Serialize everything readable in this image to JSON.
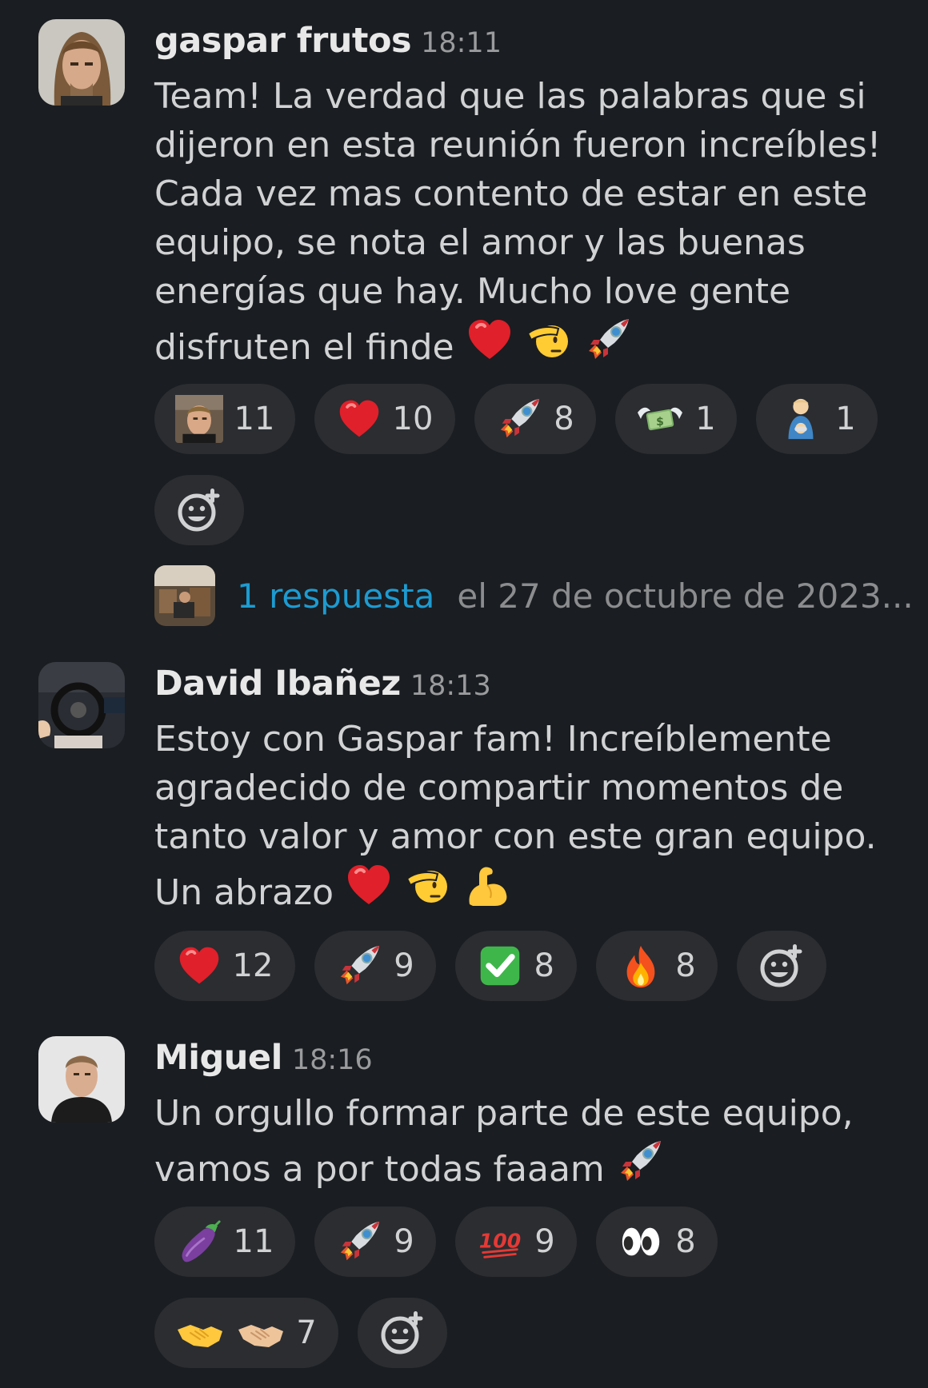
{
  "colors": {
    "background": "#1a1d21",
    "pill": "#2b2d31",
    "link": "#1d9bd1",
    "text": "#d1d2d3",
    "muted": "#9a9b9d"
  },
  "messages": [
    {
      "author": "gaspar frutos",
      "time": "18:11",
      "lines": [
        "Team! La verdad que las palabras que si",
        "dijeron en esta reunión fueron increíbles!",
        "Cada vez mas contento de estar en este",
        "equipo, se nota el amor y las buenas",
        "energías que hay. Mucho love gente",
        "disfruten el finde"
      ],
      "inline_emojis": [
        "red-heart",
        "saluting-face",
        "rocket"
      ],
      "reactions": [
        {
          "icon": "custom-face-emoji",
          "count": "11"
        },
        {
          "icon": "red-heart",
          "count": "10"
        },
        {
          "icon": "rocket",
          "count": "8"
        },
        {
          "icon": "money-with-wings",
          "count": "1"
        },
        {
          "icon": "baby-bottle-person",
          "count": "1"
        }
      ],
      "thread": {
        "replies": "1 respuesta",
        "date": "el 27 de octubre de 2023..."
      }
    },
    {
      "author": "David Ibañez",
      "time": "18:13",
      "lines": [
        "Estoy con Gaspar fam! Increíblemente",
        "agradecido de compartir momentos de",
        "tanto valor y amor con este gran equipo.",
        "Un abrazo"
      ],
      "inline_emojis": [
        "red-heart",
        "saluting-face",
        "flexed-biceps"
      ],
      "reactions": [
        {
          "icon": "red-heart",
          "count": "12"
        },
        {
          "icon": "rocket",
          "count": "9"
        },
        {
          "icon": "check-mark-button",
          "count": "8"
        },
        {
          "icon": "fire",
          "count": "8"
        }
      ]
    },
    {
      "author": "Miguel",
      "time": "18:16",
      "lines": [
        "Un orgullo formar parte de este equipo,",
        "vamos a por todas faaam"
      ],
      "inline_emojis": [
        "rocket"
      ],
      "reactions": [
        {
          "icon": "eggplant",
          "count": "11"
        },
        {
          "icon": "rocket",
          "count": "9"
        },
        {
          "icon": "hundred-points",
          "count": "9"
        },
        {
          "icon": "eyes",
          "count": "8"
        },
        {
          "icon": "handshake",
          "count": "7"
        }
      ]
    }
  ]
}
